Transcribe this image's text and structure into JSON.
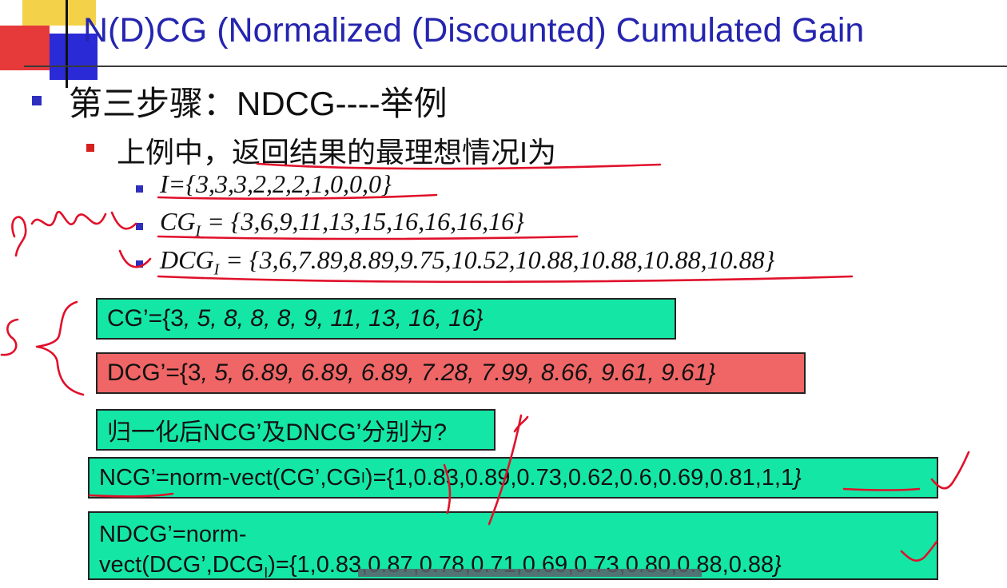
{
  "slide": {
    "title": "N(D)CG (Normalized (Discounted) Cumulated Gain",
    "step_heading": "第三步骤：NDCG----举例",
    "sub_heading": "上例中，返回结果的最理想情况I为",
    "ideal_vector": "I={3,3,3,2,2,2,1,0,0,0}",
    "cg_ideal_prefix": "CG",
    "cg_ideal_sub": "I",
    "cg_ideal_values": " = {3,6,9,11,13,15,16,16,16,16}",
    "dcg_ideal_prefix": "DCG",
    "dcg_ideal_sub": "I",
    "dcg_ideal_values": " = {3,6,7.89,8.89,9.75,10.52,10.88,10.88,10.88,10.88}",
    "cg_prime_head": "CG’={3",
    "cg_prime_tail": ", 5, 8, 8, 8, 9, 11, 13, 16, 16}",
    "dcg_prime_head": "DCG’={3",
    "dcg_prime_tail": ", 5, 6.89, 6.89, 6.89, 7.28, 7.99, 8.66, 9.61, 9.61}",
    "question": "归一化后NCG’及DNCG’分别为?",
    "ncg_head": "NCG’=norm-vect(CG’,CG",
    "ncg_sub": "I",
    "ncg_tail": ")={1,0.83,0.89,0.73,0.62,0.6,0.69,0.81,1,1",
    "ncg_brace": "}",
    "ndcg_line1": "NDCG’=norm-",
    "ndcg_head": "vect(DCG’,DCG",
    "ndcg_sub": "I",
    "ndcg_tail": ")={1,0.83,0.87,0.78,0.71,0.69,0.73,0.80,0.88,0.88",
    "ndcg_brace": "}"
  },
  "colors": {
    "title": "#2525b0",
    "green_box": "#14e6a6",
    "red_box": "#f06565",
    "ink": "#e0102a"
  }
}
